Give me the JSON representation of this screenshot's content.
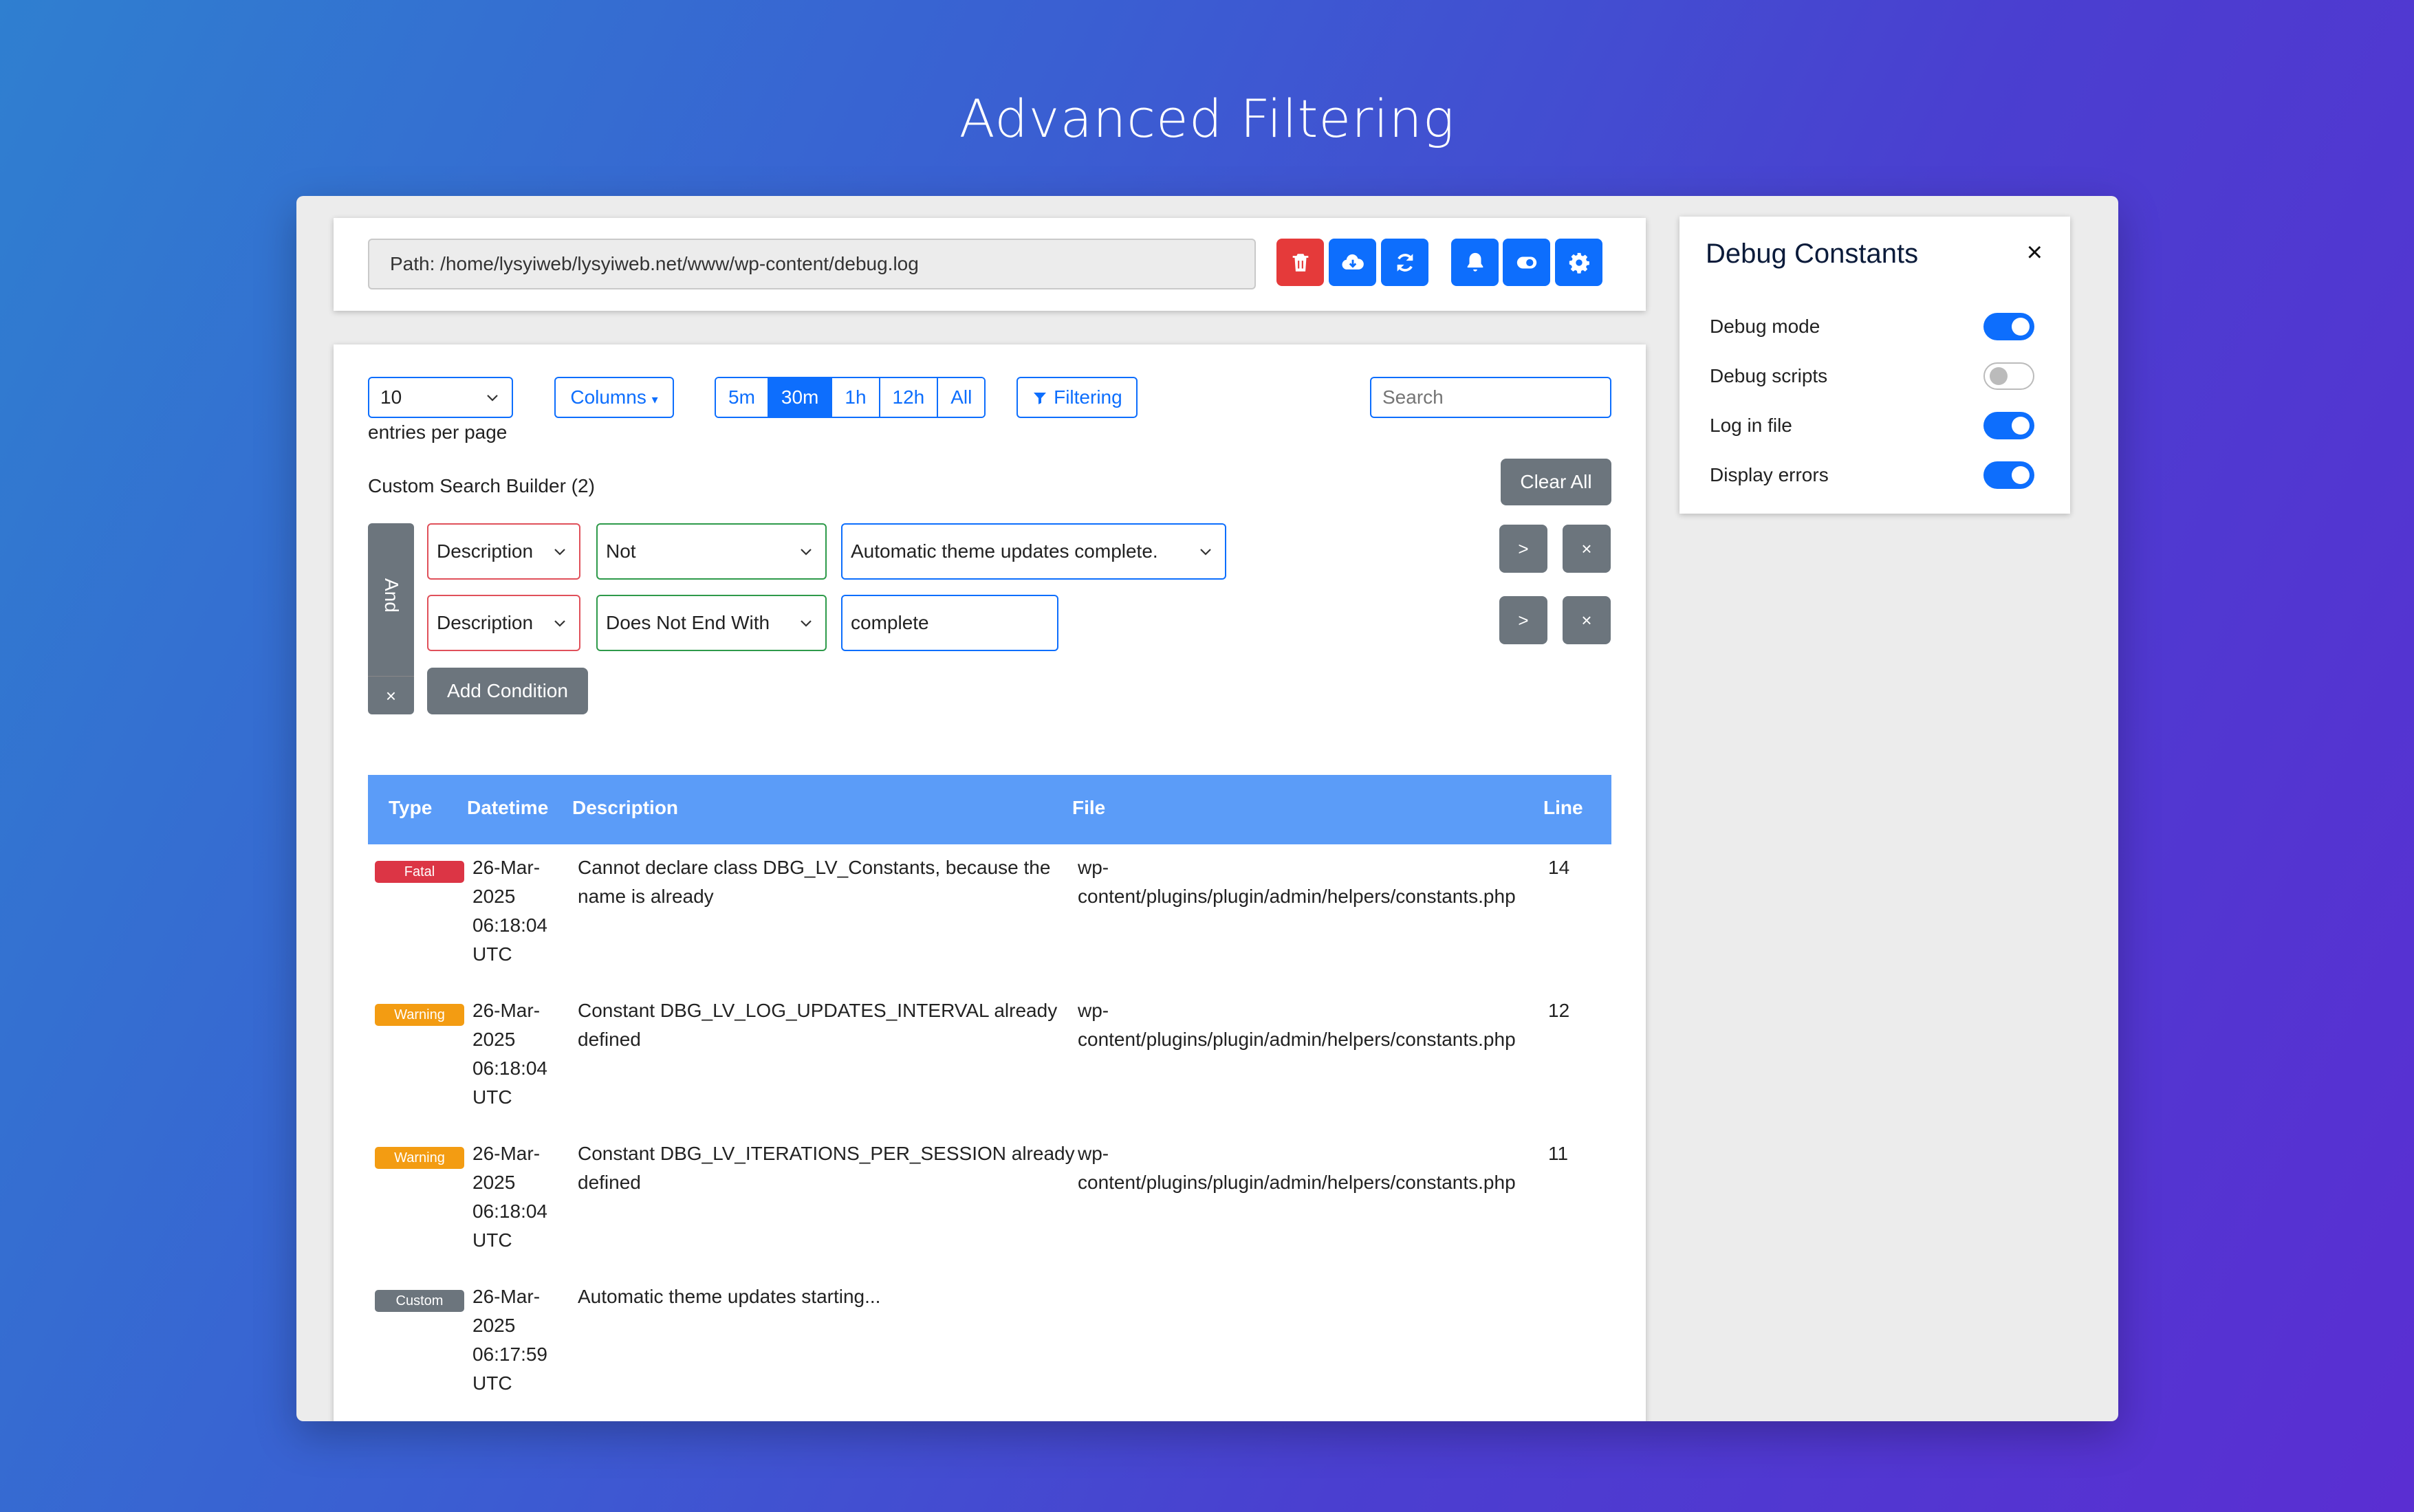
{
  "hero_title": "Advanced Filtering",
  "path": "Path: /home/lysyiweb/lysyiweb.net/www/wp-content/debug.log",
  "toolbar": {
    "icons": [
      "trash-icon",
      "cloud-download-icon",
      "refresh-icon",
      "bell-icon",
      "toggle-icon",
      "gear-icon"
    ]
  },
  "controls": {
    "entries_value": "10",
    "entries_label": "entries per page",
    "columns_label": "Columns",
    "time_ranges": [
      "5m",
      "30m",
      "1h",
      "12h",
      "All"
    ],
    "active_range": "30m",
    "filtering_label": "Filtering",
    "search_placeholder": "Search"
  },
  "search_builder": {
    "title": "Custom Search Builder (2)",
    "clear_all": "Clear All",
    "logic": "And",
    "add_condition": "Add Condition",
    "conditions": [
      {
        "column": "Description",
        "operator": "Not",
        "value": "Automatic theme updates complete."
      },
      {
        "column": "Description",
        "operator": "Does Not End With",
        "value": "complete"
      }
    ],
    "indent_label": ">",
    "remove_label": "×"
  },
  "table": {
    "headers": {
      "type": "Type",
      "datetime": "Datetime",
      "description": "Description",
      "file": "File",
      "line": "Line"
    },
    "rows": [
      {
        "type": "Fatal",
        "color": "#dc3545",
        "datetime": [
          "26-Mar-",
          "2025",
          "06:18:04",
          "UTC"
        ],
        "description": [
          "Cannot declare class DBG_LV_Constants, because the",
          "name is already"
        ],
        "file": [
          "wp-",
          "content/plugins/plugin/admin/helpers/constants.php"
        ],
        "line": "14"
      },
      {
        "type": "Warning",
        "color": "#f39c12",
        "datetime": [
          "26-Mar-",
          "2025",
          "06:18:04",
          "UTC"
        ],
        "description": [
          "Constant DBG_LV_LOG_UPDATES_INTERVAL already",
          "defined"
        ],
        "file": [
          "wp-",
          "content/plugins/plugin/admin/helpers/constants.php"
        ],
        "line": "12"
      },
      {
        "type": "Warning",
        "color": "#f39c12",
        "datetime": [
          "26-Mar-",
          "2025",
          "06:18:04",
          "UTC"
        ],
        "description": [
          "Constant DBG_LV_ITERATIONS_PER_SESSION already",
          "defined"
        ],
        "file": [
          "wp-",
          "content/plugins/plugin/admin/helpers/constants.php"
        ],
        "line": "11"
      },
      {
        "type": "Custom",
        "color": "#6c757d",
        "datetime": [
          "26-Mar-",
          "2025",
          "06:17:59",
          "UTC"
        ],
        "description": [
          "Automatic theme updates starting...",
          ""
        ],
        "file": [
          "",
          ""
        ],
        "line": ""
      }
    ]
  },
  "debug_panel": {
    "title": "Debug Constants",
    "close": "×",
    "items": [
      {
        "label": "Debug mode",
        "on": true
      },
      {
        "label": "Debug scripts",
        "on": false
      },
      {
        "label": "Log in file",
        "on": true
      },
      {
        "label": "Display errors",
        "on": true
      }
    ]
  }
}
